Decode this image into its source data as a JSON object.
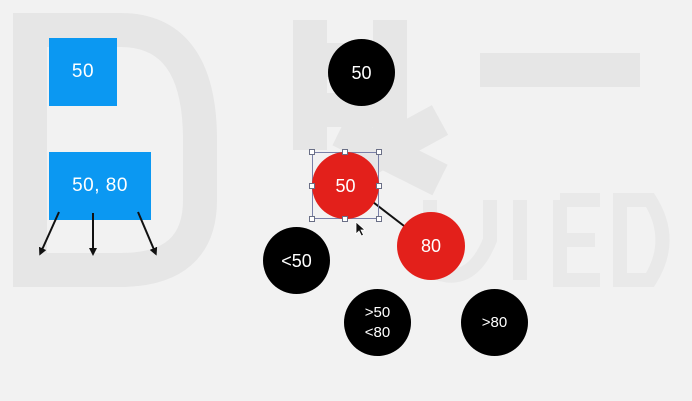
{
  "btree": {
    "single_key": "50",
    "double_key": "50, 80"
  },
  "rbtree": {
    "root": "50",
    "red_left": "50",
    "red_right": "80",
    "less_than": "<50",
    "between_top": ">50",
    "between_bottom": "<80",
    "greater_than": ">80"
  },
  "colors": {
    "box_blue": "#0b98f2",
    "node_black": "#000000",
    "node_red": "#e3201b",
    "background": "#f2f2f2"
  }
}
